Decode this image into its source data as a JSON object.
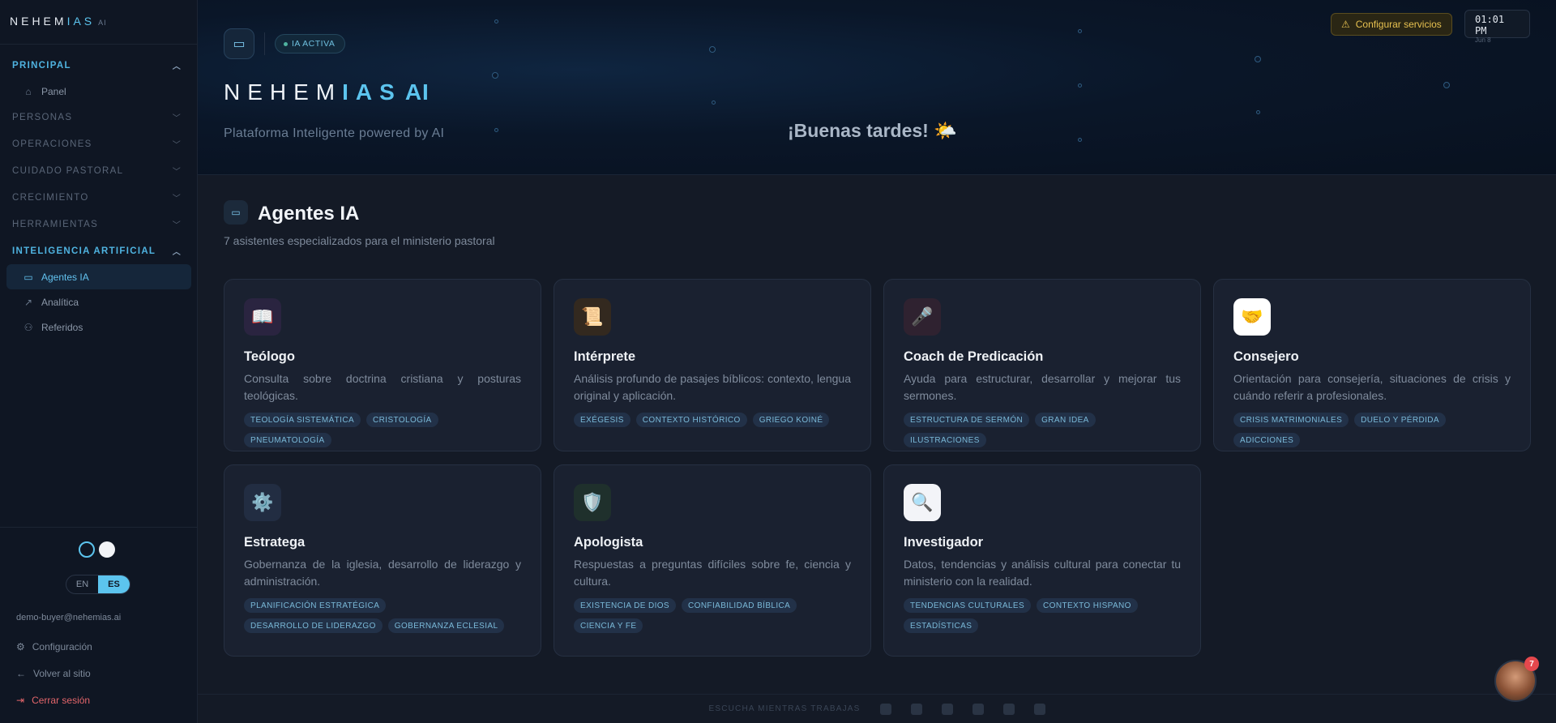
{
  "brand": {
    "name_a": "NEHEM",
    "name_b": "IAS",
    "suffix": "AI"
  },
  "sidebar": {
    "sections": [
      {
        "label": "PRINCIPAL",
        "active": true
      },
      {
        "label": "PERSONAS"
      },
      {
        "label": "OPERACIONES"
      },
      {
        "label": "CUIDADO PASTORAL"
      },
      {
        "label": "CRECIMIENTO"
      },
      {
        "label": "HERRAMIENTAS"
      },
      {
        "label": "INTELIGENCIA ARTIFICIAL",
        "active": true
      }
    ],
    "principal_items": [
      {
        "label": "Panel",
        "icon": "home-icon"
      }
    ],
    "ai_items": [
      {
        "label": "Agentes IA",
        "icon": "monitor-icon",
        "current": true
      },
      {
        "label": "Analítica",
        "icon": "trend-icon"
      },
      {
        "label": "Referidos",
        "icon": "user-plus-icon"
      }
    ],
    "lang": {
      "en": "EN",
      "es": "ES",
      "selected": "ES"
    },
    "email": "demo-buyer@nehemias.ai",
    "bottom": {
      "settings": "Configuración",
      "back": "Volver al sitio",
      "logout": "Cerrar sesión"
    }
  },
  "hero": {
    "badge": "IA ACTIVA",
    "title_a": "NEHEM",
    "title_b": "IAS",
    "title_ai": "AI",
    "subtitle": "Plataforma Inteligente powered by AI",
    "greeting": "¡Buenas tardes! 🌤️",
    "config_button": "Configurar servicios",
    "clock_time": "01:01 PM",
    "clock_date": "Jun 8"
  },
  "section": {
    "title": "Agentes IA",
    "subtitle": "7 asistentes especializados para el ministerio pastoral"
  },
  "agents": [
    {
      "name": "Teólogo",
      "icon": "📖",
      "icon_bg": "#2a2440",
      "desc": "Consulta sobre doctrina cristiana y posturas teológicas.",
      "tags": [
        "TEOLOGÍA SISTEMÁTICA",
        "CRISTOLOGÍA",
        "PNEUMATOLOGÍA"
      ]
    },
    {
      "name": "Intérprete",
      "icon": "📜",
      "icon_bg": "#33291f",
      "desc": "Análisis profundo de pasajes bíblicos: contexto, lengua original y aplicación.",
      "tags": [
        "EXÉGESIS",
        "CONTEXTO HISTÓRICO",
        "GRIEGO KOINÉ"
      ]
    },
    {
      "name": "Coach de Predicación",
      "icon": "🎤",
      "icon_bg": "#2f2230",
      "desc": "Ayuda para estructurar, desarrollar y mejorar tus sermones.",
      "tags": [
        "ESTRUCTURA DE SERMÓN",
        "GRAN IDEA",
        "ILUSTRACIONES"
      ]
    },
    {
      "name": "Consejero",
      "icon": "🤝",
      "icon_bg": "#ffffff",
      "desc": "Orientación para consejería, situaciones de crisis y cuándo referir a profesionales.",
      "tags": [
        "CRISIS MATRIMONIALES",
        "DUELO Y PÉRDIDA",
        "ADICCIONES"
      ]
    },
    {
      "name": "Estratega",
      "icon": "⚙️",
      "icon_bg": "#222d42",
      "desc": "Gobernanza de la iglesia, desarrollo de liderazgo y administración.",
      "tags": [
        "PLANIFICACIÓN ESTRATÉGICA",
        "DESARROLLO DE LIDERAZGO",
        "GOBERNANZA ECLESIAL"
      ]
    },
    {
      "name": "Apologista",
      "icon": "🛡️",
      "icon_bg": "#1f302c",
      "desc": "Respuestas a preguntas difíciles sobre fe, ciencia y cultura.",
      "tags": [
        "EXISTENCIA DE DIOS",
        "CONFIABILIDAD BÍBLICA",
        "CIENCIA Y FE"
      ]
    },
    {
      "name": "Investigador",
      "icon": "🔍",
      "icon_bg": "#f3f4f8",
      "desc": "Datos, tendencias y análisis cultural para conectar tu ministerio con la realidad.",
      "tags": [
        "TENDENCIAS CULTURALES",
        "CONTEXTO HISPANO",
        "ESTADÍSTICAS"
      ]
    }
  ],
  "footer": {
    "label": "ESCUCHA MIENTRAS TRABAJAS"
  },
  "notifications": {
    "count": "7"
  }
}
